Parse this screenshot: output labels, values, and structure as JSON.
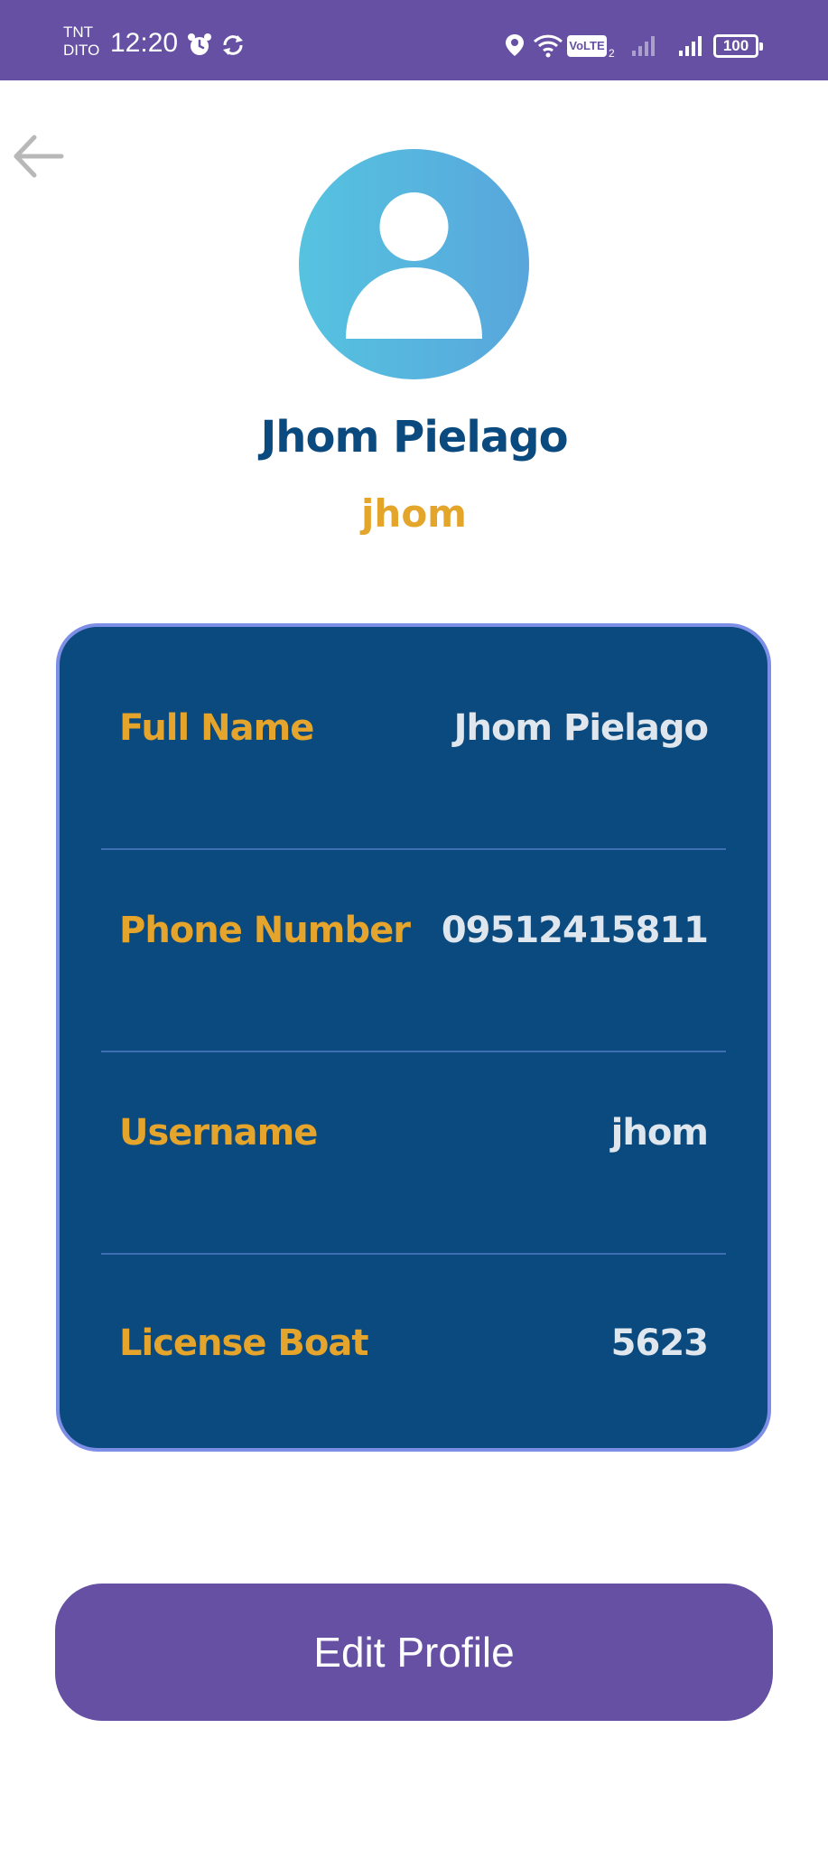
{
  "status_bar": {
    "carrier_top": "TNT",
    "carrier_bottom": "DITO",
    "time": "12:20",
    "volte": "VoLTE",
    "volte_sim": "2",
    "battery": "100",
    "icons": [
      "alarm-icon",
      "sync-icon",
      "location-icon",
      "wifi-icon",
      "signal-icon",
      "battery-icon"
    ]
  },
  "navigation": {
    "back_icon": "arrow-left-icon"
  },
  "profile": {
    "avatar_icon": "user-silhouette-icon",
    "name": "Jhom Pielago",
    "username": "jhom"
  },
  "info_card": {
    "rows": [
      {
        "label": "Full Name",
        "value": "Jhom Pielago"
      },
      {
        "label": "Phone Number",
        "value": "09512415811"
      },
      {
        "label": "Username",
        "value": "jhom"
      },
      {
        "label": "License Boat",
        "value": "5623"
      }
    ]
  },
  "actions": {
    "edit_profile_label": "Edit Profile"
  },
  "colors": {
    "primary": "#6650a4",
    "card_background": "#0a4a7e",
    "card_border": "#7d8ee6",
    "label_accent": "#e5a42b",
    "name_text": "#0b4a7e",
    "value_text": "#dfe6ee"
  }
}
